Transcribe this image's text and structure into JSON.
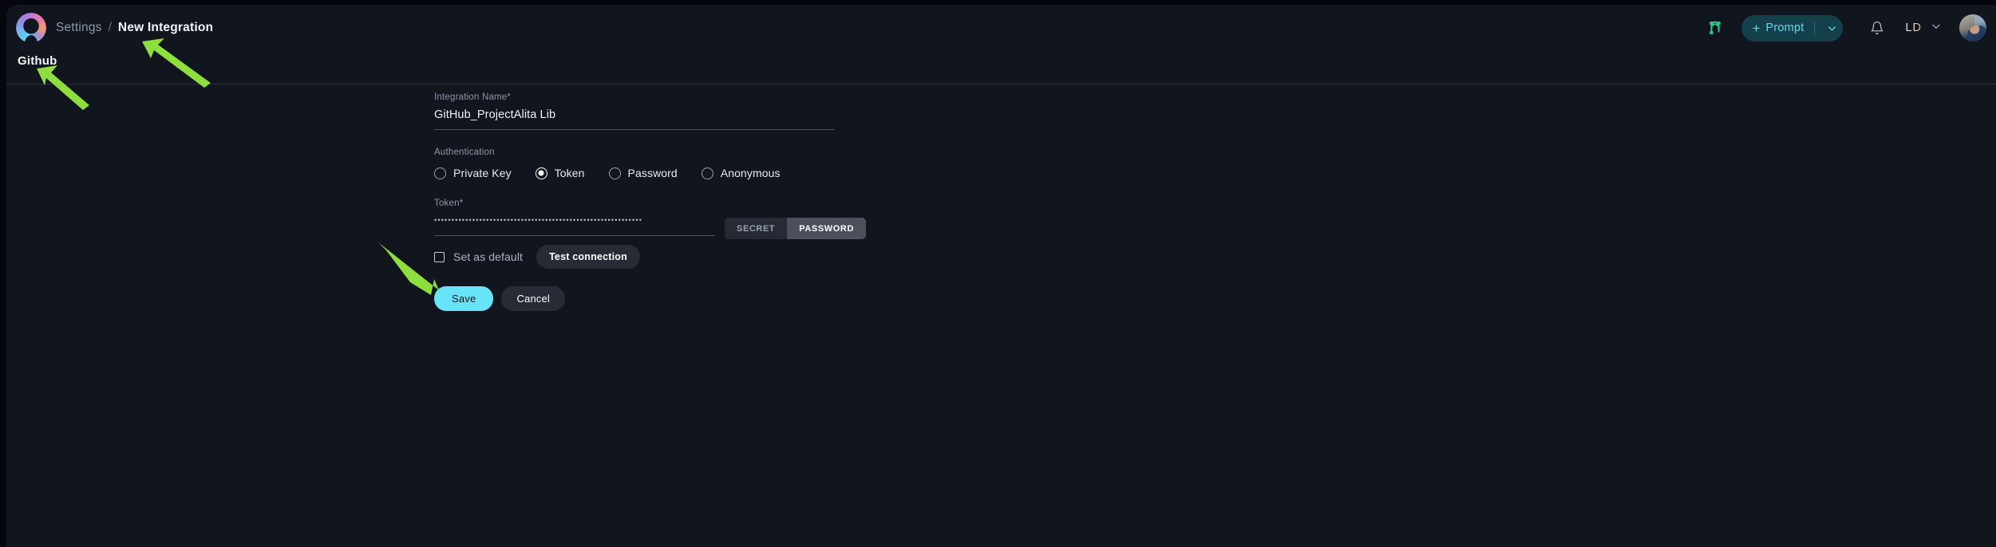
{
  "header": {
    "logo_icon": "alita-logo-icon",
    "breadcrumb": {
      "parent": "Settings",
      "separator": "/",
      "current": "New Integration"
    },
    "plug_icon": "connection-plug-icon",
    "prompt_button": {
      "plus": "+",
      "label": "Prompt",
      "caret_icon": "chevron-down-icon"
    },
    "bell_icon": "notification-bell-icon",
    "user_initials": "LD",
    "user_caret_icon": "chevron-down-icon",
    "avatar": "user-avatar"
  },
  "page": {
    "subtitle": "Github"
  },
  "form": {
    "integration_name": {
      "label": "Integration Name",
      "required_mark": "*",
      "value": "GitHub_ProjectAlita Lib",
      "placeholder": "Integration Name"
    },
    "authentication": {
      "label": "Authentication",
      "selected": "Token",
      "options": [
        {
          "label": "Private Key",
          "checked": false
        },
        {
          "label": "Token",
          "checked": true
        },
        {
          "label": "Password",
          "checked": false
        },
        {
          "label": "Anonymous",
          "checked": false
        }
      ]
    },
    "token": {
      "label": "Token",
      "required_mark": "*",
      "value": "••••••••••••••••••••••••••••••••••••••••••••••••••••••••••••",
      "placeholder": "Token",
      "toggle": {
        "secret_label": "SECRET",
        "password_label": "PASSWORD",
        "active": "PASSWORD"
      }
    },
    "set_as_default": {
      "label": "Set as default",
      "checked": false
    },
    "test_connection_label": "Test connection",
    "save_label": "Save",
    "cancel_label": "Cancel"
  },
  "colors": {
    "background": "#11151e",
    "accent_cyan": "#67e4f7",
    "prompt_bg": "#14404c",
    "prompt_text": "#62d4ec",
    "plug_green": "#2bc88a",
    "annotation_green": "#8ede3e",
    "divider": "#2b3140"
  },
  "annotations": [
    {
      "name": "arrow-to-new-integration",
      "points_to": "New Integration"
    },
    {
      "name": "arrow-to-github-title",
      "points_to": "Github"
    },
    {
      "name": "arrow-to-save-button",
      "points_to": "Save"
    }
  ]
}
